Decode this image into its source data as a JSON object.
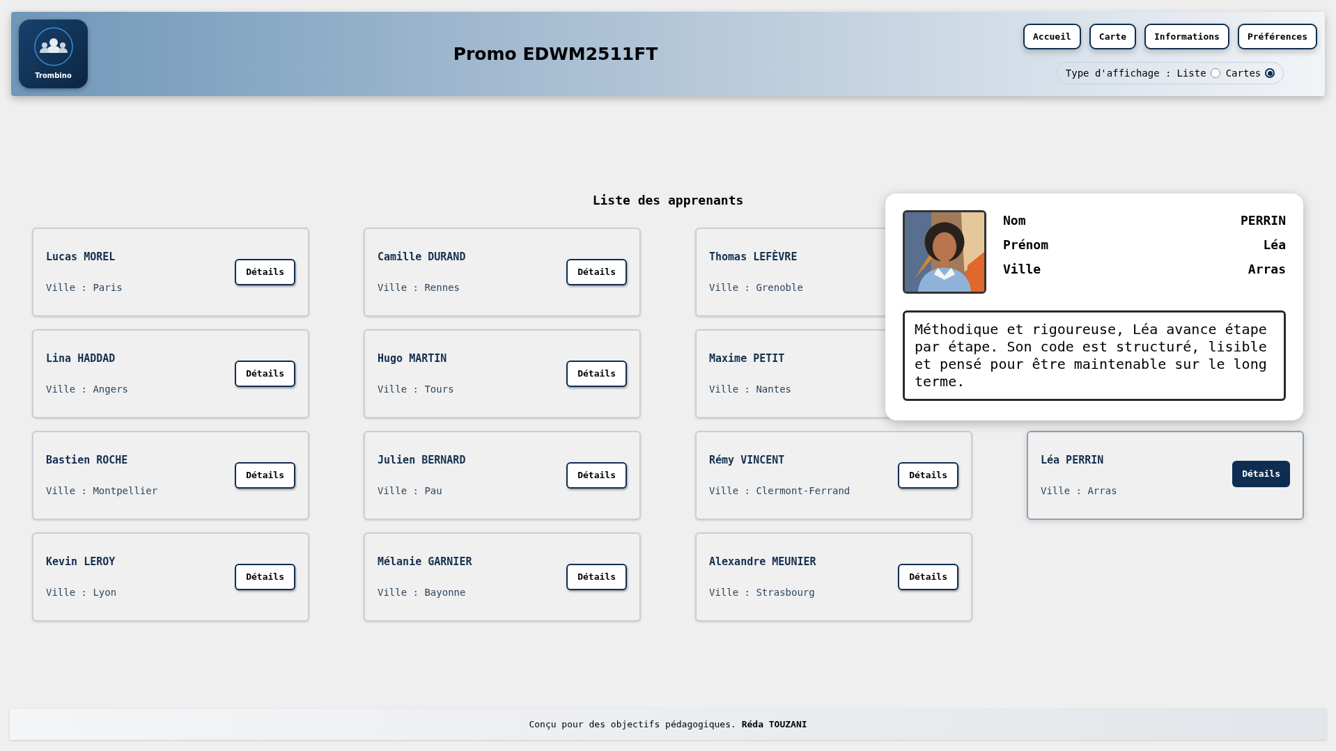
{
  "header": {
    "logo_label": "Trombino",
    "title": "Promo EDWM2511FT",
    "nav": [
      {
        "label": "Accueil"
      },
      {
        "label": "Carte"
      },
      {
        "label": "Informations"
      },
      {
        "label": "Préférences"
      }
    ],
    "display_type": {
      "label": "Type d'affichage :",
      "options": [
        {
          "label": "Liste",
          "selected": false
        },
        {
          "label": "Cartes",
          "selected": true
        }
      ]
    }
  },
  "heading": "Liste des apprenants",
  "card_rows": [
    {
      "cards": [
        {
          "name": "Lucas MOREL",
          "city": "Ville : Paris",
          "button": "Détails",
          "selected": false
        },
        {
          "name": "Camille DURAND",
          "city": "Ville : Rennes",
          "button": "Détails",
          "selected": false
        },
        {
          "name": "Thomas LEFÈVRE",
          "city": "Ville : Grenoble",
          "selected": false
        }
      ]
    },
    {
      "cards": [
        {
          "name": "Lina HADDAD",
          "city": "Ville : Angers",
          "button": "Détails",
          "selected": false
        },
        {
          "name": "Hugo MARTIN",
          "city": "Ville : Tours",
          "button": "Détails",
          "selected": false
        },
        {
          "name": "Maxime PETIT",
          "city": "Ville : Nantes",
          "selected": false
        }
      ]
    },
    {
      "cards": [
        {
          "name": "Bastien ROCHE",
          "city": "Ville : Montpellier",
          "button": "Détails",
          "selected": false
        },
        {
          "name": "Julien BERNARD",
          "city": "Ville : Pau",
          "button": "Détails",
          "selected": false
        },
        {
          "name": "Rémy VINCENT",
          "city": "Ville : Clermont-Ferrand",
          "button": "Détails",
          "selected": false
        },
        {
          "name": "Léa PERRIN",
          "city": "Ville : Arras",
          "button": "Détails",
          "selected": true
        }
      ]
    },
    {
      "cards": [
        {
          "name": "Kevin LEROY",
          "city": "Ville : Lyon",
          "button": "Détails",
          "selected": false
        },
        {
          "name": "Mélanie GARNIER",
          "city": "Ville : Bayonne",
          "button": "Détails",
          "selected": false
        },
        {
          "name": "Alexandre MEUNIER",
          "city": "Ville : Strasbourg",
          "button": "Détails",
          "selected": false
        }
      ]
    }
  ],
  "popup": {
    "fields": [
      {
        "label": "Nom",
        "value": "PERRIN"
      },
      {
        "label": "Prénom",
        "value": "Léa"
      },
      {
        "label": "Ville",
        "value": "Arras"
      }
    ],
    "description": "Méthodique et rigoureuse, Léa avance étape par étape. Son code est structuré, lisible et pensé pour être maintenable sur le long terme."
  },
  "footer": "Conçu pour des objectifs pédagogiques. **Réda TOUZANI**"
}
